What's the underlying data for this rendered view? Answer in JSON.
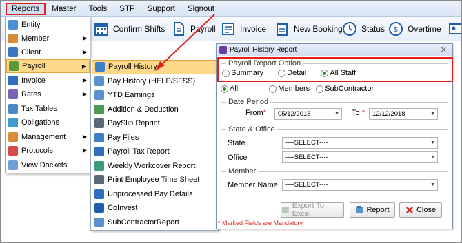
{
  "menubar": {
    "items": [
      "Reports",
      "Master",
      "Tools",
      "STP",
      "Support",
      "Signout"
    ]
  },
  "toolbar": {
    "confirm_shifts": "Confirm Shifts",
    "payroll": "Payroll",
    "invoice": "Invoice",
    "new_booking": "New Booking",
    "status": "Status",
    "overtime": "Overtime"
  },
  "reports_menu": {
    "items": [
      {
        "label": "Entity",
        "submenu": false
      },
      {
        "label": "Member",
        "submenu": true
      },
      {
        "label": "Client",
        "submenu": true
      },
      {
        "label": "Payroll",
        "submenu": true
      },
      {
        "label": "Invoice",
        "submenu": true
      },
      {
        "label": "Rates",
        "submenu": true
      },
      {
        "label": "Tax Tables",
        "submenu": false
      },
      {
        "label": "Obligations",
        "submenu": false
      },
      {
        "label": "Management",
        "submenu": true
      },
      {
        "label": "Protocols",
        "submenu": true
      },
      {
        "label": "View Dockets",
        "submenu": false
      }
    ],
    "arrow_glyph": "▶"
  },
  "payroll_submenu": {
    "items": [
      "Payroll History",
      "Pay History (HELP/SFSS)",
      "YTD Earnings",
      "Addition & Deduction",
      "PaySlip Reprint",
      "Pay Files",
      "Payroll Tax Report",
      "Weekly Workcover Report",
      "Print Employee Time Sheet",
      "Unprocessed Pay Details",
      "CoInvest",
      "SubContractorReport"
    ]
  },
  "dialog": {
    "title": "Payroll History Report",
    "close": "✕",
    "report_option": {
      "label": "Payroll Report Option",
      "options": [
        "Summary",
        "Detail",
        "All Staff"
      ],
      "selected": "All Staff"
    },
    "scope": {
      "options": [
        "All",
        "Members",
        "SubContractor"
      ],
      "selected": "All"
    },
    "date_period": {
      "label": "Date Period",
      "from_label": "From",
      "to_label": "To",
      "required_mark": "*",
      "from_value": "05/12/2018",
      "to_value": "12/12/2018"
    },
    "state_office": {
      "label": "State & Office",
      "state_label": "State",
      "office_label": "Office",
      "state_value": "----SELECT----",
      "office_value": "----SELECT----"
    },
    "member": {
      "label": "Member",
      "member_name_label": "Member Name",
      "member_name_value": "----SELECT----"
    },
    "buttons": {
      "export": "Export To Excel",
      "report": "Report",
      "close": "Close"
    },
    "mandatory_note": "* Marked Fields are Mandatory",
    "dropdown_glyph": "▼"
  },
  "colors": {
    "highlight": "#ffd88a",
    "annotation_red": "#e0221c",
    "radio_selected": "#2a8a24"
  }
}
